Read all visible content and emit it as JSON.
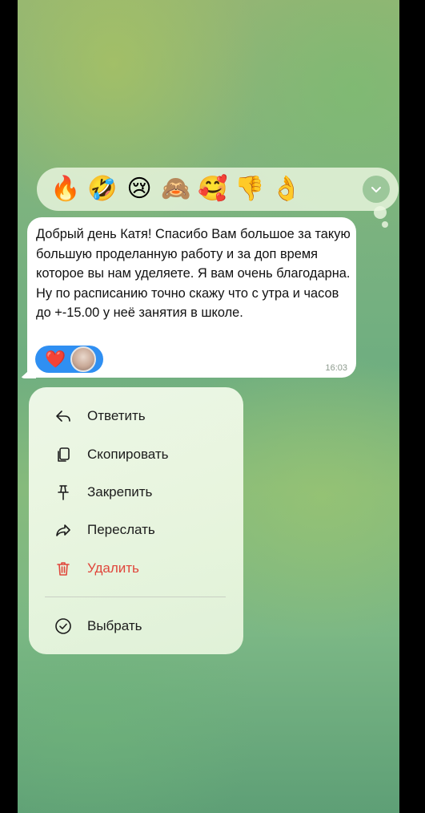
{
  "reaction_bar": {
    "reactions": [
      {
        "emoji": "🔥",
        "name": "fire"
      },
      {
        "emoji": "🤣",
        "name": "rofl"
      },
      {
        "emoji": "😢",
        "name": "crying"
      },
      {
        "emoji": "🙈",
        "name": "see-no-evil"
      },
      {
        "emoji": "🥰",
        "name": "smiling-hearts"
      },
      {
        "emoji": "👎",
        "name": "thumbs-down"
      },
      {
        "emoji": "👌",
        "name": "ok-hand"
      }
    ],
    "expand_icon": "chevron-down-icon"
  },
  "message": {
    "text": "Добрый день Катя! Спасибо Вам большое за такую большую проделанную работу  и за доп время которое вы нам уделяете. Я вам очень благодарна. Ну по расписанию точно скажу что с утра и часов до +-15.00 у неё занятия в школе.",
    "time": "16:03",
    "reaction": {
      "emoji": "❤️",
      "bubble_color": "#2f8ff2"
    }
  },
  "menu": {
    "items": [
      {
        "label": "Ответить",
        "icon": "reply-icon"
      },
      {
        "label": "Скопировать",
        "icon": "copy-icon"
      },
      {
        "label": "Закрепить",
        "icon": "pin-icon"
      },
      {
        "label": "Переслать",
        "icon": "forward-icon"
      },
      {
        "label": "Удалить",
        "icon": "trash-icon",
        "color": "#e0463b"
      },
      {
        "label": "Выбрать",
        "icon": "check-circle-icon"
      }
    ]
  }
}
